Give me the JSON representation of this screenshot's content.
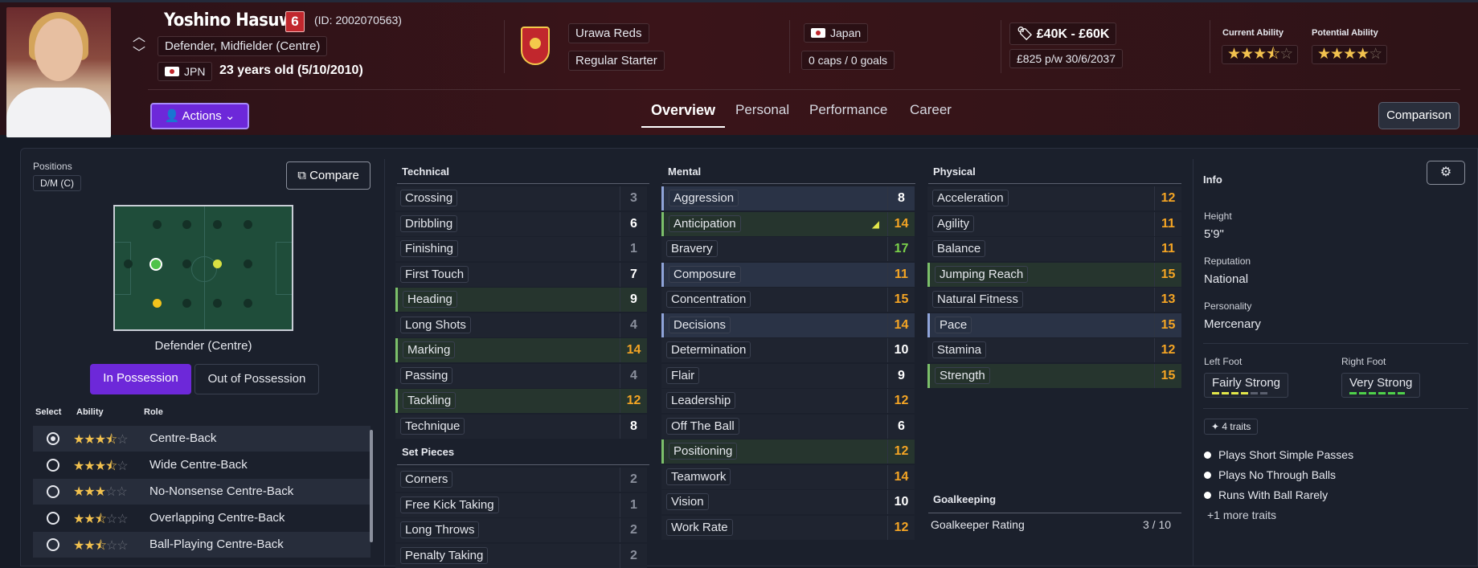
{
  "player": {
    "name": "Yoshino Hasuwa",
    "number": "6",
    "id_text": "(ID: 2002070563)",
    "positions_text": "Defender, Midfielder (Centre)",
    "nationality_code": "JPN",
    "age_text": "23 years old (5/10/2010)"
  },
  "club": {
    "name": "Urawa Reds",
    "status": "Regular Starter"
  },
  "national": {
    "country": "Japan",
    "caps": "0 caps / 0 goals"
  },
  "contract": {
    "value": "£40K - £60K",
    "wage": "£825 p/w 30/6/2037"
  },
  "ability": {
    "current_label": "Current Ability",
    "current_stars": 3.5,
    "potential_label": "Potential Ability",
    "potential_stars": 4
  },
  "toolbar": {
    "actions_label": "Actions",
    "comparison_label": "Comparison"
  },
  "tabs": [
    "Overview",
    "Personal",
    "Performance",
    "Career"
  ],
  "positions_panel": {
    "label": "Positions",
    "chip": "D/M (C)",
    "compare_label": "Compare",
    "position_name": "Defender (Centre)",
    "in_possession": "In Possession",
    "out_of_possession": "Out of Possession",
    "headers": {
      "select": "Select",
      "ability": "Ability",
      "role": "Role"
    },
    "roles": [
      {
        "name": "Centre-Back",
        "stars": 3.5,
        "selected": true
      },
      {
        "name": "Wide Centre-Back",
        "stars": 3.5,
        "selected": false
      },
      {
        "name": "No-Nonsense Centre-Back",
        "stars": 3,
        "selected": false
      },
      {
        "name": "Overlapping Centre-Back",
        "stars": 2.5,
        "selected": false
      },
      {
        "name": "Ball-Playing Centre-Back",
        "stars": 2.5,
        "selected": false
      }
    ]
  },
  "technical": {
    "title": "Technical",
    "rows": [
      {
        "name": "Crossing",
        "value": "3"
      },
      {
        "name": "Dribbling",
        "value": "6"
      },
      {
        "name": "Finishing",
        "value": "1"
      },
      {
        "name": "First Touch",
        "value": "7"
      },
      {
        "name": "Heading",
        "value": "9"
      },
      {
        "name": "Long Shots",
        "value": "4"
      },
      {
        "name": "Marking",
        "value": "14"
      },
      {
        "name": "Passing",
        "value": "4"
      },
      {
        "name": "Tackling",
        "value": "12"
      },
      {
        "name": "Technique",
        "value": "8"
      }
    ]
  },
  "set_pieces": {
    "title": "Set Pieces",
    "rows": [
      {
        "name": "Corners",
        "value": "2"
      },
      {
        "name": "Free Kick Taking",
        "value": "1"
      },
      {
        "name": "Long Throws",
        "value": "2"
      },
      {
        "name": "Penalty Taking",
        "value": "2"
      }
    ]
  },
  "mental": {
    "title": "Mental",
    "rows": [
      {
        "name": "Aggression",
        "value": "8"
      },
      {
        "name": "Anticipation",
        "value": "14"
      },
      {
        "name": "Bravery",
        "value": "17"
      },
      {
        "name": "Composure",
        "value": "11"
      },
      {
        "name": "Concentration",
        "value": "15"
      },
      {
        "name": "Decisions",
        "value": "14"
      },
      {
        "name": "Determination",
        "value": "10"
      },
      {
        "name": "Flair",
        "value": "9"
      },
      {
        "name": "Leadership",
        "value": "12"
      },
      {
        "name": "Off The Ball",
        "value": "6"
      },
      {
        "name": "Positioning",
        "value": "12"
      },
      {
        "name": "Teamwork",
        "value": "14"
      },
      {
        "name": "Vision",
        "value": "10"
      },
      {
        "name": "Work Rate",
        "value": "12"
      }
    ]
  },
  "physical": {
    "title": "Physical",
    "rows": [
      {
        "name": "Acceleration",
        "value": "12"
      },
      {
        "name": "Agility",
        "value": "11"
      },
      {
        "name": "Balance",
        "value": "11"
      },
      {
        "name": "Jumping Reach",
        "value": "15"
      },
      {
        "name": "Natural Fitness",
        "value": "13"
      },
      {
        "name": "Pace",
        "value": "15"
      },
      {
        "name": "Stamina",
        "value": "12"
      },
      {
        "name": "Strength",
        "value": "15"
      }
    ]
  },
  "goalkeeping": {
    "title": "Goalkeeping",
    "label": "Goalkeeper Rating",
    "value": "3 / 10"
  },
  "info": {
    "title": "Info",
    "height_label": "Height",
    "height": "5'9\"",
    "reputation_label": "Reputation",
    "reputation": "National",
    "personality_label": "Personality",
    "personality": "Mercenary",
    "left_foot_label": "Left Foot",
    "left_foot": "Fairly Strong",
    "right_foot_label": "Right Foot",
    "right_foot": "Very Strong",
    "traits_chip": "4 traits",
    "traits": [
      "Plays Short Simple Passes",
      "Plays No Through Balls",
      "Runs With Ball Rarely"
    ],
    "more_traits": "+1 more traits"
  },
  "colors": {
    "accent": "#6d28d9",
    "highlight_orange": "#f5a524",
    "highlight_green": "#7bd14a"
  }
}
